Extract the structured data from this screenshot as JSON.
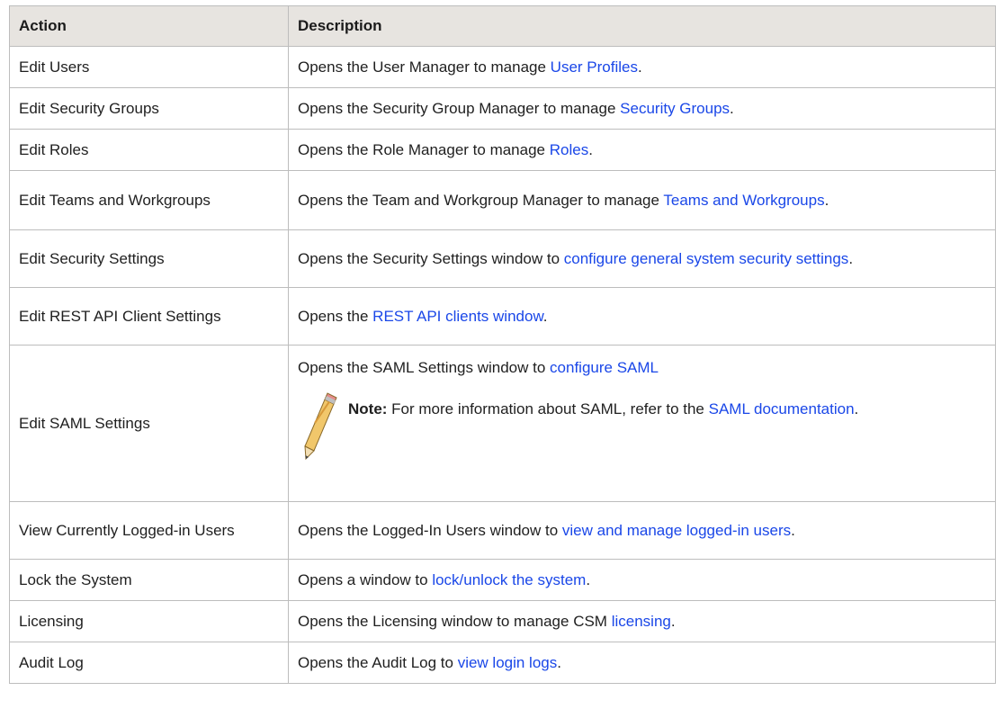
{
  "header": {
    "action": "Action",
    "description": "Description"
  },
  "rows": [
    {
      "action": "Edit Users",
      "desc_pre": "Opens the User Manager to manage ",
      "link": "User Profiles",
      "desc_post": "."
    },
    {
      "action": "Edit Security Groups",
      "desc_pre": "Opens the Security Group Manager to manage ",
      "link": "Security Groups",
      "desc_post": "."
    },
    {
      "action": "Edit Roles",
      "desc_pre": "Opens the Role Manager to manage ",
      "link": "Roles",
      "desc_post": "."
    },
    {
      "action": "Edit Teams and Workgroups",
      "desc_pre": "Opens the Team and Workgroup Manager to manage ",
      "link": "Teams and Workgroups",
      "desc_post": "."
    },
    {
      "action": "Edit Security Settings",
      "desc_pre": "Opens the Security Settings window to ",
      "link": "configure general system security settings",
      "desc_post": "."
    },
    {
      "action": "Edit REST API Client Settings",
      "desc_pre": "Opens the ",
      "link": "REST API clients window",
      "desc_post": "."
    },
    {
      "action": "Edit SAML Settings",
      "desc_pre": "Opens the SAML Settings window to ",
      "link": "configure SAML",
      "desc_post": "",
      "note": {
        "label": "Note:",
        "pre": " For more information about SAML, refer to the ",
        "link": "SAML documentation",
        "post": "."
      }
    },
    {
      "action": "View Currently Logged-in Users",
      "desc_pre": "Opens the Logged-In Users window to ",
      "link": "view and manage logged-in users",
      "desc_post": "."
    },
    {
      "action": "Lock the System",
      "desc_pre": "Opens a window to ",
      "link": "lock/unlock the system",
      "desc_post": "."
    },
    {
      "action": "Licensing",
      "desc_pre": "Opens the Licensing window to manage CSM ",
      "link": "licensing",
      "desc_post": "."
    },
    {
      "action": "Audit Log",
      "desc_pre": "Opens the Audit Log to ",
      "link": "view login logs",
      "desc_post": "."
    }
  ],
  "icons": {
    "note": "pencil-icon"
  },
  "colors": {
    "link": "#1a47e8",
    "header_bg": "#e7e4e0",
    "border": "#bdbdbd"
  }
}
